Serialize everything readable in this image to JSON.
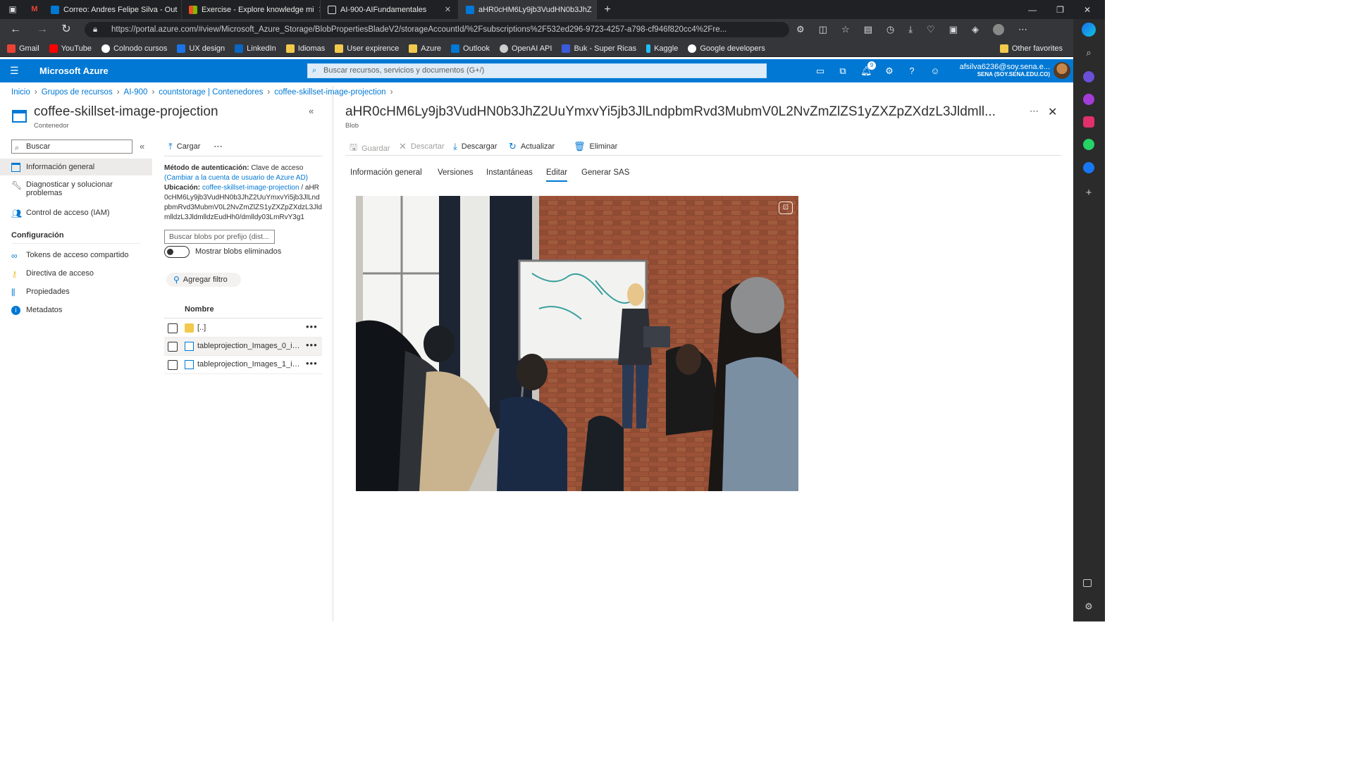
{
  "browser": {
    "tabs": [
      {
        "title": "Correo: Andres Felipe Silva - Out",
        "active": false
      },
      {
        "title": "Exercise - Explore knowledge mi",
        "active": false
      },
      {
        "title": "AI-900-AIFundamentales",
        "active": false
      },
      {
        "title": "aHR0cHM6Ly9jb3VudHN0b3JhZ",
        "active": true
      }
    ],
    "url": "https://portal.azure.com/#view/Microsoft_Azure_Storage/BlobPropertiesBladeV2/storageAccountId/%2Fsubscriptions%2F532ed296-9723-4257-a798-cf946f820cc4%2Fre...",
    "bookmarks": [
      "Gmail",
      "YouTube",
      "Colnodo cursos",
      "UX design",
      "LinkedIn",
      "Idiomas",
      "User expirence",
      "Azure",
      "Outlook",
      "OpenAI API",
      "Buk - Super Ricas",
      "Kaggle",
      "Google developers"
    ],
    "other_favorites": "Other favorites"
  },
  "azure": {
    "brand": "Microsoft Azure",
    "search_placeholder": "Buscar recursos, servicios y documentos (G+/)",
    "notification_count": "9",
    "user_name": "afsilva6236@soy.sena.e...",
    "user_org": "SENA (SOY.SENA.EDU.CO)"
  },
  "breadcrumb": [
    "Inicio",
    "Grupos de recursos",
    "AI-900",
    "countstorage | Contenedores",
    "coffee-skillset-image-projection"
  ],
  "left": {
    "title": "coffee-skillset-image-projection",
    "subtitle": "Contenedor",
    "search_placeholder": "Buscar",
    "nav": [
      "Información general",
      "Diagnosticar y solucionar problemas",
      "Control de acceso (IAM)"
    ],
    "section": "Configuración",
    "config_items": [
      "Tokens de acceso compartido",
      "Directiva de acceso",
      "Propiedades",
      "Metadatos"
    ]
  },
  "middle": {
    "upload_label": "Cargar",
    "auth_label": "Método de autenticación:",
    "auth_value": "Clave de acceso",
    "auth_link": "(Cambiar a la cuenta de usuario de Azure AD)",
    "location_label": "Ubicación:",
    "location_link": "coffee-skillset-image-projection",
    "location_path": "/ aHR0cHM6Ly9jb3VudHN0b3JhZ2UuYmxvYi5jb3JlLndpbmRvd3MubmV0L2NvZmZlZS1yZXZpZXdzL3JldmlldzL3JldmlldzEudHh0/dmlldy03LmRvY3g1",
    "prefix_placeholder": "Buscar blobs por prefijo (dist...",
    "toggle_label": "Mostrar blobs eliminados",
    "add_filter": "Agregar filtro",
    "col_name": "Nombre",
    "rows": [
      "[..]",
      "tableprojection_Images_0_img...",
      "tableprojection_Images_1_img..."
    ]
  },
  "right": {
    "title": "aHR0cHM6Ly9jb3VudHN0b3JhZ2UuYmxvYi5jb3JlLndpbmRvd3MubmV0L2NvZmZlZS1yZXZpZXdzL3Jldmll...",
    "subtitle": "Blob",
    "commands": {
      "save": "Guardar",
      "discard": "Descartar",
      "download": "Descargar",
      "refresh": "Actualizar",
      "delete": "Eliminar"
    },
    "tabs": [
      "Información general",
      "Versiones",
      "Instantáneas",
      "Editar",
      "Generar SAS"
    ],
    "selected_tab": "Editar"
  },
  "colors": {
    "accent": "#0078d4",
    "header": "#0078d4"
  }
}
